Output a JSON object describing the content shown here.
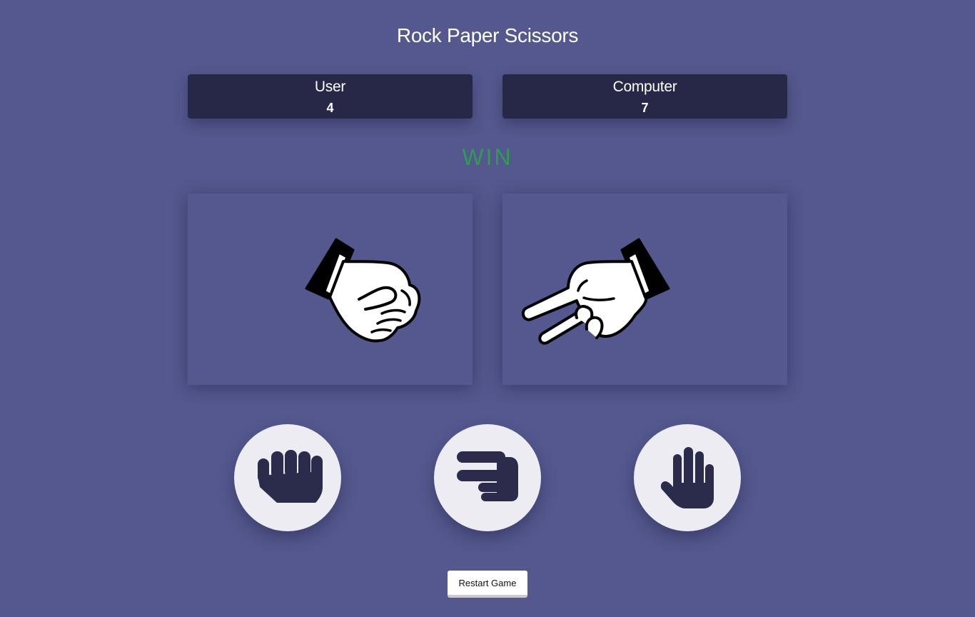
{
  "app": {
    "title": "Rock Paper Scissors"
  },
  "scoreboard": {
    "user": {
      "label": "User",
      "score": "4"
    },
    "computer": {
      "label": "Computer",
      "score": "7"
    }
  },
  "result": {
    "text": "WIN",
    "color": "#2f9c52"
  },
  "display": {
    "user_hand": "rock-hand-icon",
    "computer_hand": "scissors-hand-icon"
  },
  "choices": [
    {
      "name": "rock",
      "icon": "rock-icon"
    },
    {
      "name": "scissors",
      "icon": "scissors-icon"
    },
    {
      "name": "paper",
      "icon": "paper-icon"
    }
  ],
  "controls": {
    "restart_label": "Restart Game"
  },
  "colors": {
    "background": "#54588e",
    "score_card": "#272848",
    "choice_button": "#ececf2",
    "choice_icon": "#2b2c4c"
  }
}
